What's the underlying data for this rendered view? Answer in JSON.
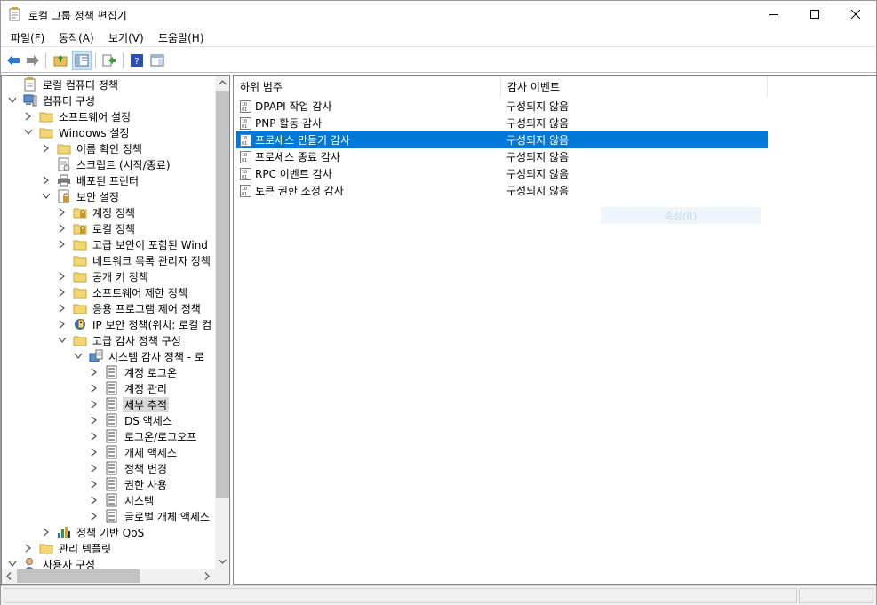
{
  "window": {
    "title": "로컬 그룹 정책 편집기"
  },
  "menu": [
    {
      "label": "파일(F)"
    },
    {
      "label": "동작(A)"
    },
    {
      "label": "보기(V)"
    },
    {
      "label": "도움말(H)"
    }
  ],
  "toolbar": {
    "buttons": [
      "back-icon",
      "forward-icon",
      "up-folder-icon",
      "show-hide-tree-icon",
      "export-list-icon",
      "help-icon",
      "properties-pane-icon"
    ]
  },
  "tree": {
    "items": [
      {
        "label": "로컬 컴퓨터 정책"
      },
      {
        "label": "컴퓨터 구성"
      },
      {
        "label": "소프트웨어 설정"
      },
      {
        "label": "Windows 설정"
      },
      {
        "label": "이름 확인 정책"
      },
      {
        "label": "스크립트 (시작/종료)"
      },
      {
        "label": "배포된 프린터"
      },
      {
        "label": "보안 설정"
      },
      {
        "label": "계정 정책"
      },
      {
        "label": "로컬 정책"
      },
      {
        "label": "고급 보안이 포함된 Wind"
      },
      {
        "label": "네트워크 목록 관리자 정책"
      },
      {
        "label": "공개 키 정책"
      },
      {
        "label": "소프트웨어 제한 정책"
      },
      {
        "label": "응용 프로그램 제어 정책"
      },
      {
        "label": "IP 보안 정책(위치: 로컬 컴"
      },
      {
        "label": "고급 감사 정책 구성"
      },
      {
        "label": "시스템 감사 정책 - 로"
      },
      {
        "label": "계정 로그온"
      },
      {
        "label": "계정 관리"
      },
      {
        "label": "세부 추적"
      },
      {
        "label": "DS 액세스"
      },
      {
        "label": "로그온/로그오프"
      },
      {
        "label": "개체 액세스"
      },
      {
        "label": "정책 변경"
      },
      {
        "label": "권한 사용"
      },
      {
        "label": "시스템"
      },
      {
        "label": "글로벌 개체 액세스"
      },
      {
        "label": "정책 기반 QoS"
      },
      {
        "label": "관리 템플릿"
      },
      {
        "label": "사용자 구성"
      }
    ]
  },
  "list": {
    "columns": [
      "하위 범주",
      "감사 이벤트"
    ],
    "rows": [
      {
        "name": "DPAPI 작업 감사",
        "value": "구성되지 않음"
      },
      {
        "name": "PNP 활동 감사",
        "value": "구성되지 않음"
      },
      {
        "name": "프로세스 만들기 감사",
        "value": "구성되지 않음"
      },
      {
        "name": "프로세스 종료 감사",
        "value": "구성되지 않음"
      },
      {
        "name": "RPC 이벤트 감사",
        "value": "구성되지 않음"
      },
      {
        "name": "토큰 권한 조정 감사",
        "value": "구성되지 않음"
      }
    ],
    "ghost_tooltip": "속성(R)"
  },
  "colors": {
    "selection": "#0078d7",
    "toolbar_active": "#cce4f7"
  }
}
